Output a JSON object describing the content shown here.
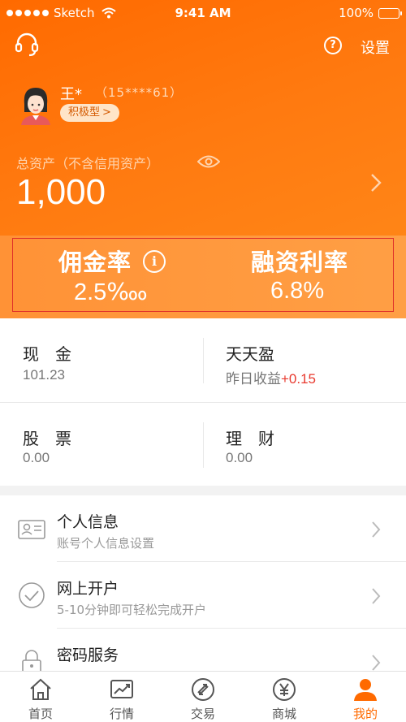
{
  "status_bar": {
    "carrier": "Sketch",
    "time": "9:41 AM",
    "battery": "100%"
  },
  "header": {
    "settings_label": "设置",
    "help_symbol": "?"
  },
  "user": {
    "name": "王*",
    "phone": "（15****61）",
    "risk_level": "积极型",
    "risk_chevron": ">"
  },
  "assets": {
    "label": "总资产（不含信用资产）",
    "value": "1,000"
  },
  "rates": {
    "commission_label": "佣金率",
    "commission_value": "2.5‱",
    "margin_label": "融资利率",
    "margin_value": "6.8%",
    "info_symbol": "i"
  },
  "accounts": [
    {
      "title": "现　金",
      "value": "101.23"
    },
    {
      "title": "天天盈",
      "value_prefix": "昨日收益",
      "value_highlight": "+0.15"
    },
    {
      "title": "股　票",
      "value": "0.00"
    },
    {
      "title": "理　财",
      "value": "0.00"
    }
  ],
  "menu": [
    {
      "title": "个人信息",
      "subtitle": "账号个人信息设置",
      "icon": "id-card-icon"
    },
    {
      "title": "网上开户",
      "subtitle": "5-10分钟即可轻松完成开户",
      "icon": "check-circle-icon"
    },
    {
      "title": "密码服务",
      "subtitle": "",
      "icon": "lock-icon"
    }
  ],
  "tabs": [
    {
      "label": "首页",
      "icon": "home-icon"
    },
    {
      "label": "行情",
      "icon": "chart-icon"
    },
    {
      "label": "交易",
      "icon": "trade-icon"
    },
    {
      "label": "商城",
      "icon": "yen-icon"
    },
    {
      "label": "我的",
      "icon": "user-icon",
      "active": true
    }
  ],
  "colors": {
    "brand": "#ff6a00",
    "gain": "#e8392e",
    "highlight_box": "#e0312a"
  }
}
